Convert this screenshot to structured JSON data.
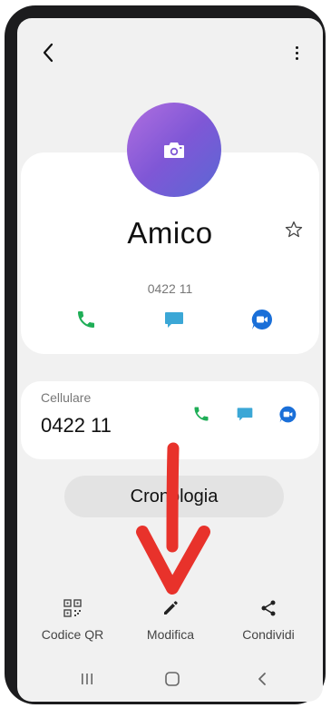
{
  "contact": {
    "name": "Amico",
    "number_header": "0422 11"
  },
  "phone_entry": {
    "label": "Cellulare",
    "number": "0422 11"
  },
  "history_button": "Cronologia",
  "bottom_actions": [
    {
      "label": "Codice QR",
      "icon": "qr-code-icon"
    },
    {
      "label": "Modifica",
      "icon": "pencil-icon"
    },
    {
      "label": "Condividi",
      "icon": "share-icon"
    }
  ],
  "colors": {
    "call": "#1fae57",
    "message": "#3ba7d6",
    "video": "#1a6fd8",
    "annotation_arrow": "#e8322b"
  }
}
